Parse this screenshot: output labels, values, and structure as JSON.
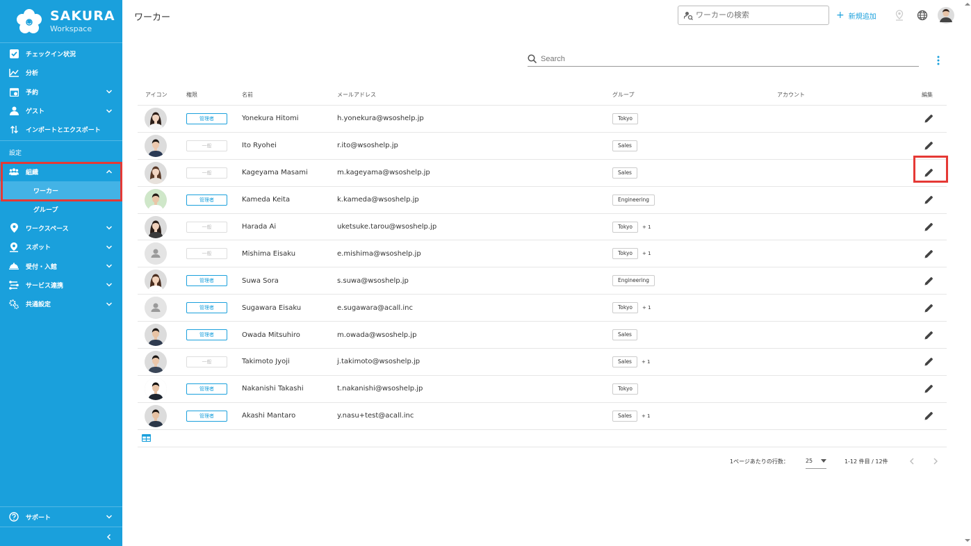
{
  "app": {
    "name": "SAKURA",
    "sub": "Workspace"
  },
  "header": {
    "title": "ワーカー",
    "search_placeholder": "ワーカーの検索",
    "add_label": "新規追加"
  },
  "sidebar": {
    "items": [
      {
        "label": "チェックイン状況",
        "icon": "checkbox-icon",
        "chev": false
      },
      {
        "label": "分析",
        "icon": "chart-icon",
        "chev": false
      },
      {
        "label": "予約",
        "icon": "calendar-icon",
        "chev": true
      },
      {
        "label": "ゲスト",
        "icon": "guest-icon",
        "chev": true
      },
      {
        "label": "インポートとエクスポート",
        "icon": "import-export-icon",
        "chev": false
      }
    ],
    "section_label": "設定",
    "org": {
      "label": "組織",
      "icon": "people-icon"
    },
    "org_sub": [
      {
        "label": "ワーカー"
      },
      {
        "label": "グループ"
      }
    ],
    "items2": [
      {
        "label": "ワークスペース",
        "icon": "location-pin-icon"
      },
      {
        "label": "スポット",
        "icon": "spot-pin-icon"
      },
      {
        "label": "受付・入館",
        "icon": "reception-bell-icon"
      },
      {
        "label": "サービス連携",
        "icon": "integration-icon"
      },
      {
        "label": "共通設定",
        "icon": "gears-icon"
      }
    ],
    "support": "サポート"
  },
  "table": {
    "search_placeholder": "Search",
    "columns": [
      "アイコン",
      "権限",
      "名前",
      "メールアドレス",
      "グループ",
      "アカウント",
      "編集"
    ],
    "rows": [
      {
        "role": "管理者",
        "role_type": "admin",
        "name": "Yonekura Hitomi",
        "email": "h.yonekura@wsoshelp.jp",
        "group": "Tokyo",
        "more": "",
        "avatar": "woman-a"
      },
      {
        "role": "一般",
        "role_type": "general",
        "name": "Ito Ryohei",
        "email": "r.ito@wsoshelp.jp",
        "group": "Sales",
        "more": "",
        "avatar": "man-a"
      },
      {
        "role": "一般",
        "role_type": "general",
        "name": "Kageyama Masami",
        "email": "m.kageyama@wsoshelp.jp",
        "group": "Sales",
        "more": "",
        "avatar": "woman-b"
      },
      {
        "role": "管理者",
        "role_type": "admin",
        "name": "Kameda Keita",
        "email": "k.kameda@wsoshelp.jp",
        "group": "Engineering",
        "more": "",
        "avatar": "man-b"
      },
      {
        "role": "一般",
        "role_type": "general",
        "name": "Harada Ai",
        "email": "uketsuke.tarou@wsoshelp.jp",
        "group": "Tokyo",
        "more": "+ 1",
        "avatar": "woman-c"
      },
      {
        "role": "一般",
        "role_type": "general",
        "name": "Mishima Eisaku",
        "email": "e.mishima@wsoshelp.jp",
        "group": "Tokyo",
        "more": "+ 1",
        "avatar": "placeholder"
      },
      {
        "role": "管理者",
        "role_type": "admin",
        "name": "Suwa Sora",
        "email": "s.suwa@wsoshelp.jp",
        "group": "Engineering",
        "more": "",
        "avatar": "woman-d"
      },
      {
        "role": "管理者",
        "role_type": "admin",
        "name": "Sugawara Eisaku",
        "email": "e.sugawara@acall.inc",
        "group": "Tokyo",
        "more": "+ 1",
        "avatar": "placeholder"
      },
      {
        "role": "管理者",
        "role_type": "admin",
        "name": "Owada Mitsuhiro",
        "email": "m.owada@wsoshelp.jp",
        "group": "Sales",
        "more": "",
        "avatar": "man-c"
      },
      {
        "role": "一般",
        "role_type": "general",
        "name": "Takimoto Jyoji",
        "email": "j.takimoto@wsoshelp.jp",
        "group": "Sales",
        "more": "+ 1",
        "avatar": "man-d"
      },
      {
        "role": "管理者",
        "role_type": "admin",
        "name": "Nakanishi Takashi",
        "email": "t.nakanishi@wsoshelp.jp",
        "group": "Tokyo",
        "more": "",
        "avatar": "man-e"
      },
      {
        "role": "管理者",
        "role_type": "admin",
        "name": "Akashi Mantaro",
        "email": "y.nasu+test@acall.inc",
        "group": "Sales",
        "more": "+ 1",
        "avatar": "man-f"
      }
    ]
  },
  "pagination": {
    "rows_per_page_label": "1ページあたりの行数：",
    "rows_per_page": "25",
    "range": "1-12 件目 / 12件"
  },
  "colors": {
    "brand": "#1aa0dc",
    "highlight": "#e53935"
  }
}
